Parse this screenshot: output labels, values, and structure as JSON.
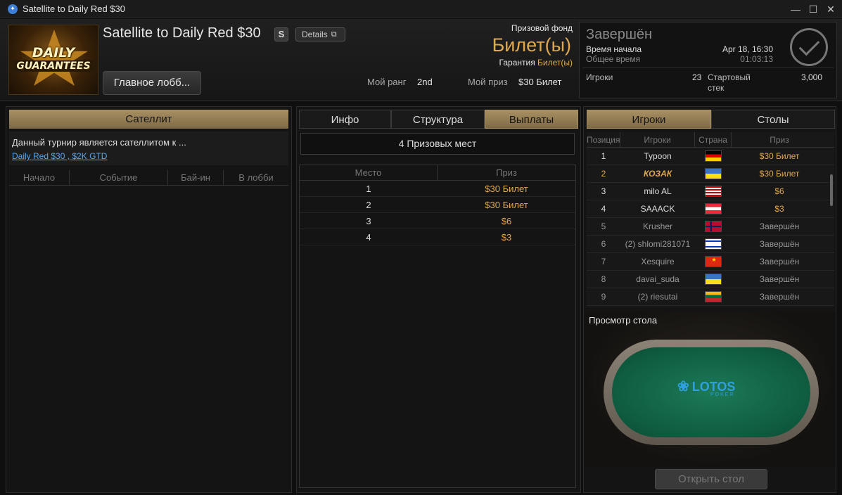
{
  "window": {
    "title": "Satellite to Daily Red $30"
  },
  "header": {
    "logo_line1": "DAILY",
    "logo_line2": "GUARANTEES",
    "tournament_name": "Satellite to Daily Red $30",
    "speed_badge": "S",
    "details_label": "Details",
    "main_lobby_label": "Главное лобб...",
    "prize_fund_label": "Призовой фонд",
    "prize_fund_value": "Билет(ы)",
    "guarantee_label": "Гарантия",
    "guarantee_value": "Билет(ы)",
    "my_rank_label": "Мой ранг",
    "my_rank_value": "2nd",
    "my_prize_label": "Мой приз",
    "my_prize_value": "$30 Билет"
  },
  "status": {
    "title": "Завершён",
    "start_label": "Время начала",
    "start_value": "Apr 18, 16:30",
    "total_label": "Общее время",
    "total_value": "01:03:13",
    "players_label": "Игроки",
    "players_value": "23",
    "stack_label": "Стартовый стек",
    "stack_value": "3,000"
  },
  "left_panel": {
    "header": "Сателлит",
    "satellite_text": "Данный турнир является сателлитом к ...",
    "satellite_link": "Daily Red $30 , $2K GTD",
    "columns": [
      "Начало",
      "Событие",
      "Бай-ин",
      "В лобби"
    ]
  },
  "mid_panel": {
    "tabs": [
      "Инфо",
      "Структура",
      "Выплаты"
    ],
    "active_tab": "Выплаты",
    "prize_places": "4 Призовых мест",
    "columns": [
      "Место",
      "Приз"
    ],
    "rows": [
      {
        "place": "1",
        "prize": "$30 Билет"
      },
      {
        "place": "2",
        "prize": "$30 Билет"
      },
      {
        "place": "3",
        "prize": "$6"
      },
      {
        "place": "4",
        "prize": "$3"
      }
    ]
  },
  "right_panel": {
    "tabs": [
      "Игроки",
      "Столы"
    ],
    "active_tab": "Игроки",
    "columns": [
      "Позиция",
      "Игроки",
      "Страна",
      "Приз"
    ],
    "players": [
      {
        "pos": "1",
        "name": "Typoon",
        "flag": "germany",
        "prize": "$30 Билет"
      },
      {
        "pos": "2",
        "name": "КОЗАК",
        "flag": "ukraine",
        "prize": "$30 Билет"
      },
      {
        "pos": "3",
        "name": "milo AL",
        "flag": "malaysia",
        "prize": "$6"
      },
      {
        "pos": "4",
        "name": "SAAACK",
        "flag": "austria",
        "prize": "$3"
      },
      {
        "pos": "5",
        "name": "Krusher",
        "flag": "norway",
        "prize": "Завершён"
      },
      {
        "pos": "6",
        "name": "(2) shlomi281071",
        "flag": "israel",
        "prize": "Завершён"
      },
      {
        "pos": "7",
        "name": "Xesquire",
        "flag": "china",
        "prize": "Завершён"
      },
      {
        "pos": "8",
        "name": "davai_suda",
        "flag": "ukraine",
        "prize": "Завершён"
      },
      {
        "pos": "9",
        "name": "(2) riesutai",
        "flag": "lithuania",
        "prize": "Завершён"
      }
    ],
    "preview_label": "Просмотр стола",
    "table_logo": "LOTOS",
    "table_logo_sub": "POKER",
    "open_table_label": "Открыть стол"
  },
  "colors": {
    "gold": "#a99064",
    "prize": "#e0a850",
    "link": "#5aa6e8"
  }
}
